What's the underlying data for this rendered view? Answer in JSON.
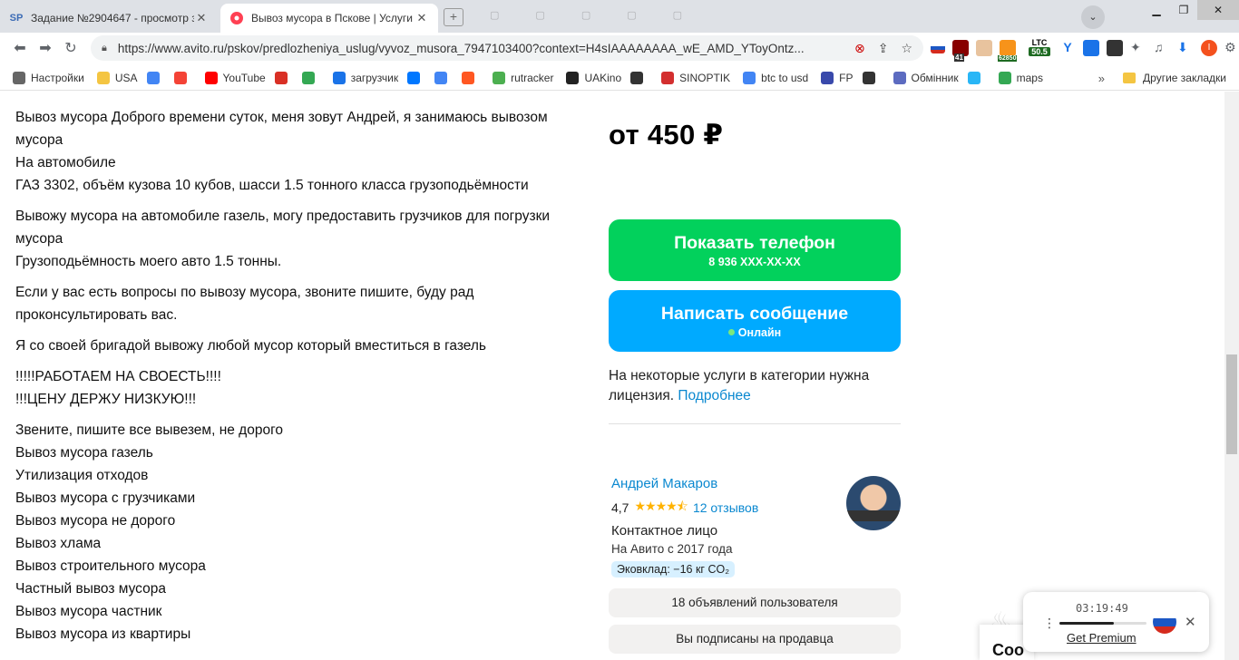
{
  "browser": {
    "tabs": [
      {
        "label": "Задание №2904647 - просмотр з",
        "favicon": "SP"
      },
      {
        "label": "Вывоз мусора в Пскове | Услуги |",
        "favicon": "avito-icon"
      }
    ],
    "url": "https://www.avito.ru/pskov/predlozheniya_uslug/vyvoz_musora_7947103400?context=H4sIAAAAAAAA_wE_AMD_YToyOntz...",
    "ext_ltc_label": "LTC",
    "ext_ltc_value": "50.5",
    "ext_btc_value": "62850",
    "ext_badge_41": "41",
    "bookmarks": [
      {
        "label": "Настройки",
        "color": "#666666"
      },
      {
        "label": "USA",
        "color": "#f4c542"
      },
      {
        "label": "",
        "color": "#4285f4"
      },
      {
        "label": "",
        "color": "#f44336"
      },
      {
        "label": "YouTube",
        "color": "#ff0000"
      },
      {
        "label": "",
        "color": "#d93025"
      },
      {
        "label": "",
        "color": "#34a853"
      },
      {
        "label": "загрузчик",
        "color": "#1a73e8"
      },
      {
        "label": "",
        "color": "#0077ff"
      },
      {
        "label": "",
        "color": "#4285f4"
      },
      {
        "label": "",
        "color": "#ff5722"
      },
      {
        "label": "rutracker",
        "color": "#4caf50"
      },
      {
        "label": "UAKino",
        "color": "#222222"
      },
      {
        "label": "",
        "color": "#333333"
      },
      {
        "label": "SINOPTIK",
        "color": "#d32f2f"
      },
      {
        "label": "btc to usd",
        "color": "#4285f4"
      },
      {
        "label": "FP",
        "color": "#3949ab"
      },
      {
        "label": "",
        "color": "#333333"
      },
      {
        "label": "Обмінник",
        "color": "#5c6bc0"
      },
      {
        "label": "",
        "color": "#29b6f6"
      },
      {
        "label": "maps",
        "color": "#34a853"
      }
    ],
    "bookmarks_more": "»",
    "other_bookmarks": "Другие закладки"
  },
  "listing": {
    "description": [
      [
        "Вывоз мусора Доброго времени суток, меня зовут Андрей, я занимаюсь вывозом мусора",
        "На автомобиле",
        "ГАЗ 3302, объём кузова 10 кубов, шасси 1.5 тонного класса грузоподьёмности"
      ],
      [
        "Вывожу мусора на автомобиле газель, могу предоставить грузчиков для погрузки мусора",
        "Грузоподьёмность моего авто 1.5 тонны."
      ],
      [
        "Если у вас есть вопросы по вывозу мусора, звоните пишите, буду рад проконсультировать вас."
      ],
      [
        "Я со своей бригадой вывожу любой мусор который вместиться в газель"
      ],
      [
        "!!!!!РАБОТАЕМ НА СВОЕСТЬ!!!!",
        "!!!ЦЕНУ ДЕРЖУ НИЗКУЮ!!!"
      ],
      [
        "Звените, пишите все вывезем, не дорого",
        "Вывоз мусора газель",
        "Утилизация отходов",
        "Вывоз мусора с грузчиками",
        "Вывоз мусора не дорого",
        "Вывоз хлама",
        "Вывоз строительного мусора",
        "Частный вывоз мусора",
        "Вывоз мусора частник",
        "Вывоз мусора из квартиры"
      ]
    ],
    "price": "от 450 ₽",
    "show_phone_label": "Показать телефон",
    "phone_masked": "8 936 XXX-XX-XX",
    "message_label": "Написать сообщение",
    "online_label": "Онлайн",
    "license_text": "На некоторые услуги в категории нужна лицензия.",
    "license_link": "Подробнее"
  },
  "seller": {
    "name": "Андрей Макаров",
    "rating": "4,7",
    "rating_value": 4.7,
    "reviews": "12 отзывов",
    "role": "Контактное лицо",
    "since": "На Авито с 2017 года",
    "eco": "Эковклад: −16 кг CO₂",
    "listings_button": "18 объявлений пользователя",
    "subscribed_button": "Вы подписаны на продавца"
  },
  "cookie_partial": "Coo",
  "widget": {
    "time": "03:19:49",
    "progress": 0.62,
    "premium": "Get Premium"
  },
  "colors": {
    "phone_green": "#02d15c",
    "message_blue": "#00aaff",
    "link_blue": "#0a88d0",
    "star_gold": "#ffb200"
  }
}
